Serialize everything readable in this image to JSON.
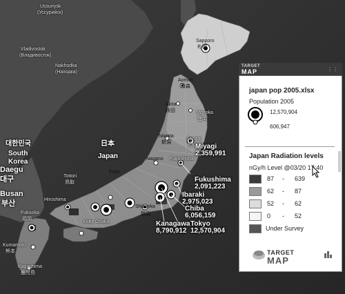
{
  "map": {
    "cities": [
      {
        "id": "ussuriysk",
        "text": "Ussuriysk"
      },
      {
        "id": "ussuriysk-ru",
        "text": "(Уссурийск)"
      },
      {
        "id": "vladivostok",
        "text": "Vladivostok"
      },
      {
        "id": "vladivostok-ru",
        "text": "(Владивосток)"
      },
      {
        "id": "nakhodka",
        "text": "Nakhodka"
      },
      {
        "id": "nakhodka-ru",
        "text": "(Находка)"
      },
      {
        "id": "sapporo",
        "text": "Sapporo"
      },
      {
        "id": "sapporo-jp",
        "text": "札幌"
      },
      {
        "id": "aomori",
        "text": "Aomori"
      },
      {
        "id": "aomori-jp",
        "text": "青森"
      },
      {
        "id": "akita",
        "text": "Akita"
      },
      {
        "id": "akita-jp",
        "text": "秋田"
      },
      {
        "id": "morioka",
        "text": "Morioka"
      },
      {
        "id": "morioka-jp",
        "text": "盛岡"
      },
      {
        "id": "niigata",
        "text": "Niigata"
      },
      {
        "id": "niigata-jp",
        "text": "新潟"
      },
      {
        "id": "sendai",
        "text": "Sendai"
      },
      {
        "id": "sendai-jp",
        "text": "仙台"
      },
      {
        "id": "nagano",
        "text": "Nagano"
      },
      {
        "id": "fukushima-city",
        "text": "Fukushima"
      },
      {
        "id": "tottori",
        "text": "Tottori"
      },
      {
        "id": "tottori-jp",
        "text": "鳥取"
      },
      {
        "id": "fukui",
        "text": "Fuku"
      },
      {
        "id": "hiroshima",
        "text": "Hiroshima"
      },
      {
        "id": "osaka",
        "text": "Osaka"
      },
      {
        "id": "kobe",
        "text": "Kobe"
      },
      {
        "id": "shizuoka",
        "text": "Shizuoka"
      },
      {
        "id": "shizuoka-jp",
        "text": "静岡"
      },
      {
        "id": "fukuoka",
        "text": "Fukuoka"
      },
      {
        "id": "fukuoka-jp",
        "text": "福岡"
      },
      {
        "id": "kumamoto",
        "text": "Kumamoto"
      },
      {
        "id": "kumamoto-jp",
        "text": "熊本"
      },
      {
        "id": "kagoshima",
        "text": "Kagoshima"
      },
      {
        "id": "kagoshima-jp",
        "text": "鹿児島"
      },
      {
        "id": "busan",
        "text": "Busan"
      },
      {
        "id": "busan-kr",
        "text": "부산"
      },
      {
        "id": "daegu",
        "text": "Daegu"
      },
      {
        "id": "daegu-kr",
        "text": "대구"
      }
    ],
    "countries": [
      {
        "id": "korea-kr",
        "text": "대한민국"
      },
      {
        "id": "south",
        "text": "South"
      },
      {
        "id": "korea",
        "text": "Korea"
      },
      {
        "id": "japan-jp",
        "text": "日本"
      },
      {
        "id": "japan",
        "text": "Japan"
      }
    ],
    "prefectures": [
      {
        "name": "Miyagi",
        "value": "2,359,991"
      },
      {
        "name": "Fukushima",
        "value": "2,091,223"
      },
      {
        "name": "Ibaraki",
        "value": "2,975,023"
      },
      {
        "name": "Chiba",
        "value": "6,056,159"
      },
      {
        "name": "Kanagawa",
        "value": "8,790,912"
      },
      {
        "name": "Tokyo",
        "value": "12,570,904"
      }
    ]
  },
  "panel": {
    "brand_top": "TARGET",
    "brand_bottom": "MAP",
    "population": {
      "title": "japan pop 2005.xlsx",
      "subtitle": "Population 2005",
      "max_label": "12,570,904",
      "min_label": "606,947"
    },
    "radiation": {
      "title": "Japan Radiation levels",
      "subtitle": "nGy/h Level @03/20 17:40",
      "ranges": [
        {
          "from": "87",
          "sep": "-",
          "to": "639",
          "color": "#3a3a3a"
        },
        {
          "from": "62",
          "sep": "-",
          "to": "87",
          "color": "#9a9a9a"
        },
        {
          "from": "52",
          "sep": "-",
          "to": "62",
          "color": "#dcdcdc"
        },
        {
          "from": "0",
          "sep": "-",
          "to": "52",
          "color": "#f4f4f4"
        }
      ],
      "survey_label": "Under Survey",
      "survey_color": "#555555"
    },
    "footer_top": "TARGET",
    "footer_bottom": "MAP"
  }
}
